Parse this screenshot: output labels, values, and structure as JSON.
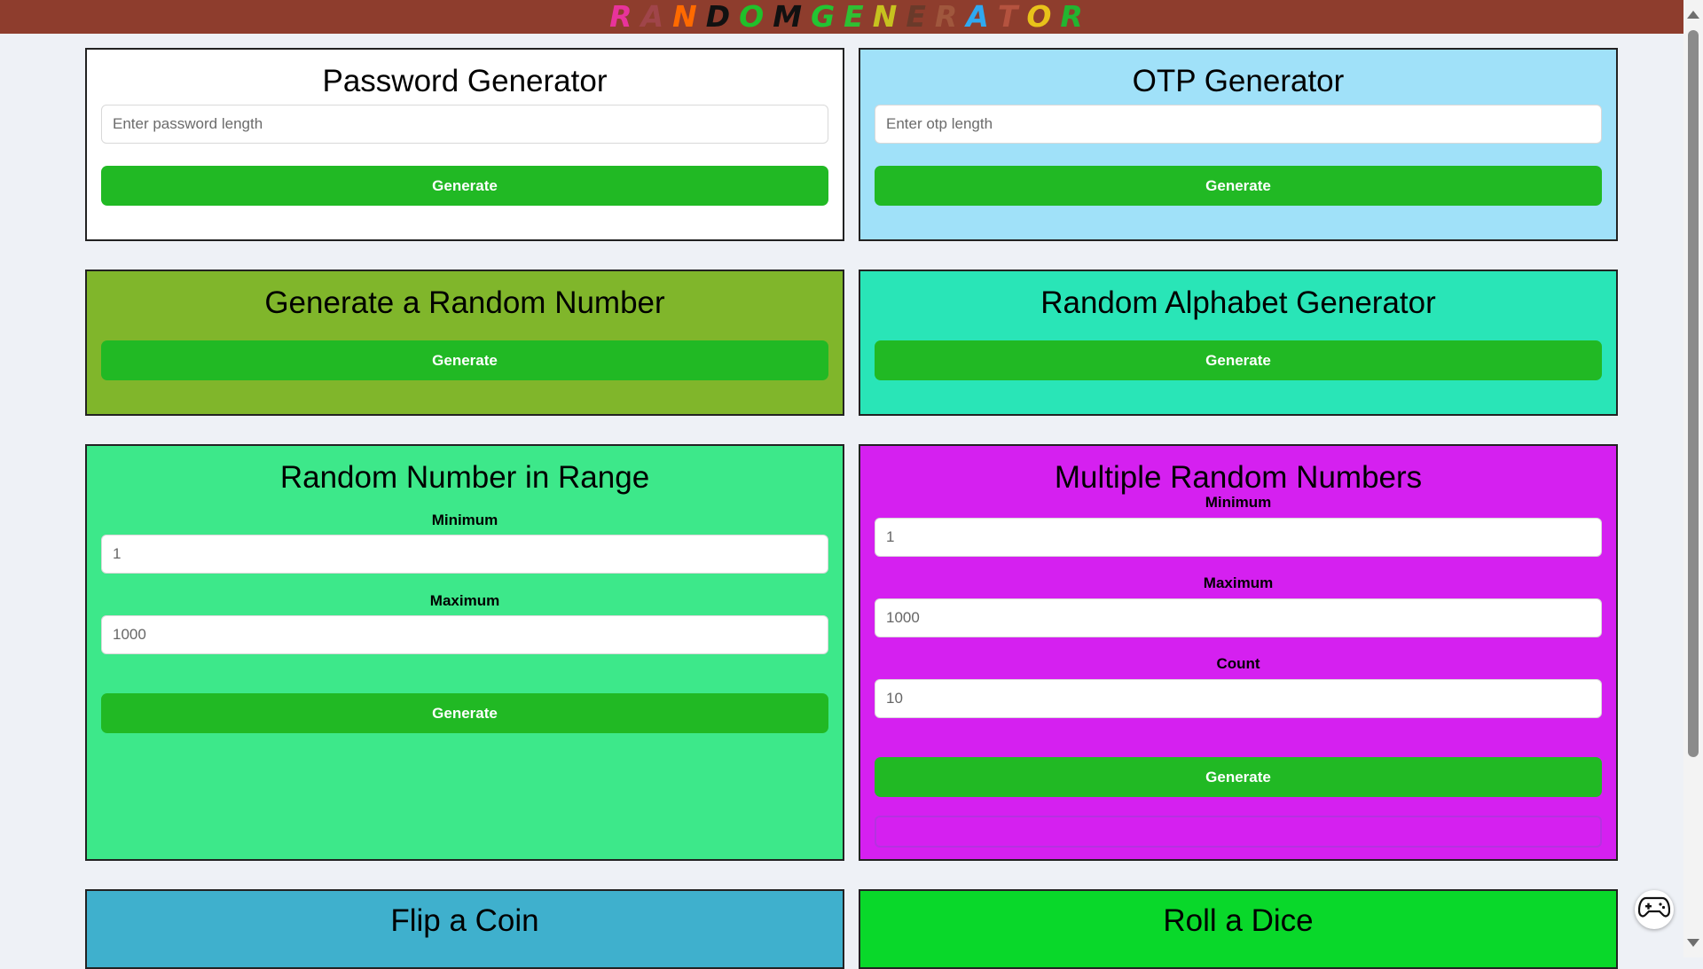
{
  "header": {
    "logo_letters": [
      {
        "ch": "R",
        "color": "#e8339b"
      },
      {
        "ch": "A",
        "color": "#a0454a"
      },
      {
        "ch": "N",
        "color": "#ff6a00"
      },
      {
        "ch": "D",
        "color": "#111111"
      },
      {
        "ch": "O",
        "color": "#20c02a"
      },
      {
        "ch": "M",
        "color": "#111111"
      },
      {
        "ch": "G",
        "color": "#22c532"
      },
      {
        "ch": "E",
        "color": "#2fbf33"
      },
      {
        "ch": "N",
        "color": "#c7c21f"
      },
      {
        "ch": "E",
        "color": "#6a3a2a"
      },
      {
        "ch": "R",
        "color": "#a0573d"
      },
      {
        "ch": "A",
        "color": "#2fa8f0"
      },
      {
        "ch": "T",
        "color": "#b5533f"
      },
      {
        "ch": "O",
        "color": "#e8c21a"
      },
      {
        "ch": "R",
        "color": "#22b530"
      }
    ]
  },
  "cards": {
    "password": {
      "title": "Password Generator",
      "placeholder": "Enter password length",
      "button": "Generate",
      "bg": "#ffffff"
    },
    "otp": {
      "title": "OTP Generator",
      "placeholder": "Enter otp length",
      "button": "Generate",
      "bg": "#a0e1f9"
    },
    "random_number": {
      "title": "Generate a Random Number",
      "button": "Generate",
      "bg": "#80b62b"
    },
    "random_alphabet": {
      "title": "Random Alphabet Generator",
      "button": "Generate",
      "bg": "#29e5b7"
    },
    "range": {
      "title": "Random Number in Range",
      "min_label": "Minimum",
      "min_value": "1",
      "max_label": "Maximum",
      "max_value": "1000",
      "button": "Generate",
      "bg": "#3de88a"
    },
    "multiple": {
      "title": "Multiple Random Numbers",
      "min_label": "Minimum",
      "min_value": "1",
      "max_label": "Maximum",
      "max_value": "1000",
      "count_label": "Count",
      "count_value": "10",
      "button": "Generate",
      "bg": "#d520f0"
    },
    "coin": {
      "title": "Flip a Coin",
      "bg": "#3fb0cd"
    },
    "dice": {
      "title": "Roll a Dice",
      "bg": "#09d82a"
    }
  },
  "icons": {
    "fab": "gamepad-icon"
  }
}
